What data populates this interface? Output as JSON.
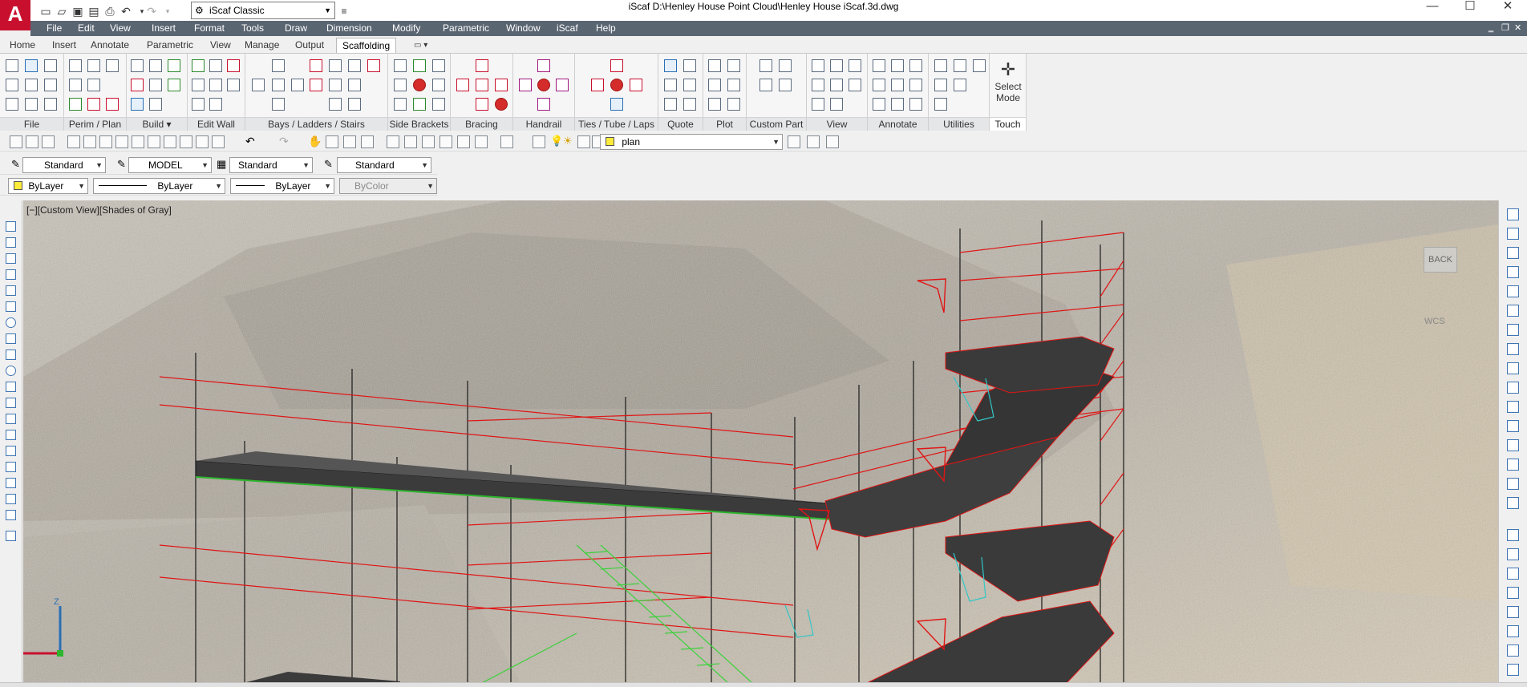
{
  "app": {
    "logo_letter": "A",
    "workspace": "iScaf Classic",
    "title": "iScaf     D:\\Henley House Point Cloud\\Henley House iScaf.3d.dwg",
    "window_controls": [
      "—",
      "☐",
      "✕"
    ]
  },
  "menu": {
    "items": [
      "File",
      "Edit",
      "View",
      "Insert",
      "Format",
      "Tools",
      "Draw",
      "Dimension",
      "Modify",
      "Parametric",
      "Window",
      "iScaf",
      "Help"
    ],
    "mdi_controls": [
      "‗",
      "❐",
      "✕"
    ]
  },
  "ribbon": {
    "tabs": [
      "Home",
      "Insert",
      "Annotate",
      "Parametric",
      "View",
      "Manage",
      "Output",
      "Scaffolding",
      "▭ ▾"
    ],
    "active_tab": "Scaffolding",
    "panels": [
      "File",
      "Perim / Plan",
      "Build ▾",
      "Edit Wall",
      "Bays /  Ladders / Stairs",
      "Side Brackets",
      "Bracing",
      "Handrail",
      "Ties / Tube / Laps",
      "Quote",
      "Plot",
      "Custom Part",
      "View",
      "Annotate",
      "Utilities",
      "Touch"
    ],
    "select_mode": "Select\nMode",
    "select_mode_line1": "Select",
    "select_mode_line2": "Mode"
  },
  "toolbar": {
    "layer": "plan",
    "text_style": "Standard",
    "dim_style": "MODEL",
    "table_style": "Standard",
    "multileader_style": "Standard",
    "color": "ByLayer",
    "linetype": "ByLayer",
    "lineweight": "ByLayer",
    "plotstyle": "ByColor"
  },
  "viewport": {
    "label": "[−][Custom View][Shades of Gray]",
    "viewcube_face": "BACK",
    "ucs_label": "WCS",
    "axis_label": "Z"
  },
  "colors": {
    "accent": "#c8102e",
    "menubar": "#5a6572",
    "scaffold_line": "#e01515",
    "deck": "#3b3b3b",
    "bracket": "#33c6c6",
    "ladder": "#3bd13b"
  },
  "icons": [
    "new-icon",
    "open-icon",
    "save-icon",
    "saveas-icon",
    "print-icon",
    "undo-icon",
    "redo-icon",
    "pan-icon",
    "zoom-icon",
    "layer-icon",
    "axis-icon",
    "gear-icon"
  ]
}
